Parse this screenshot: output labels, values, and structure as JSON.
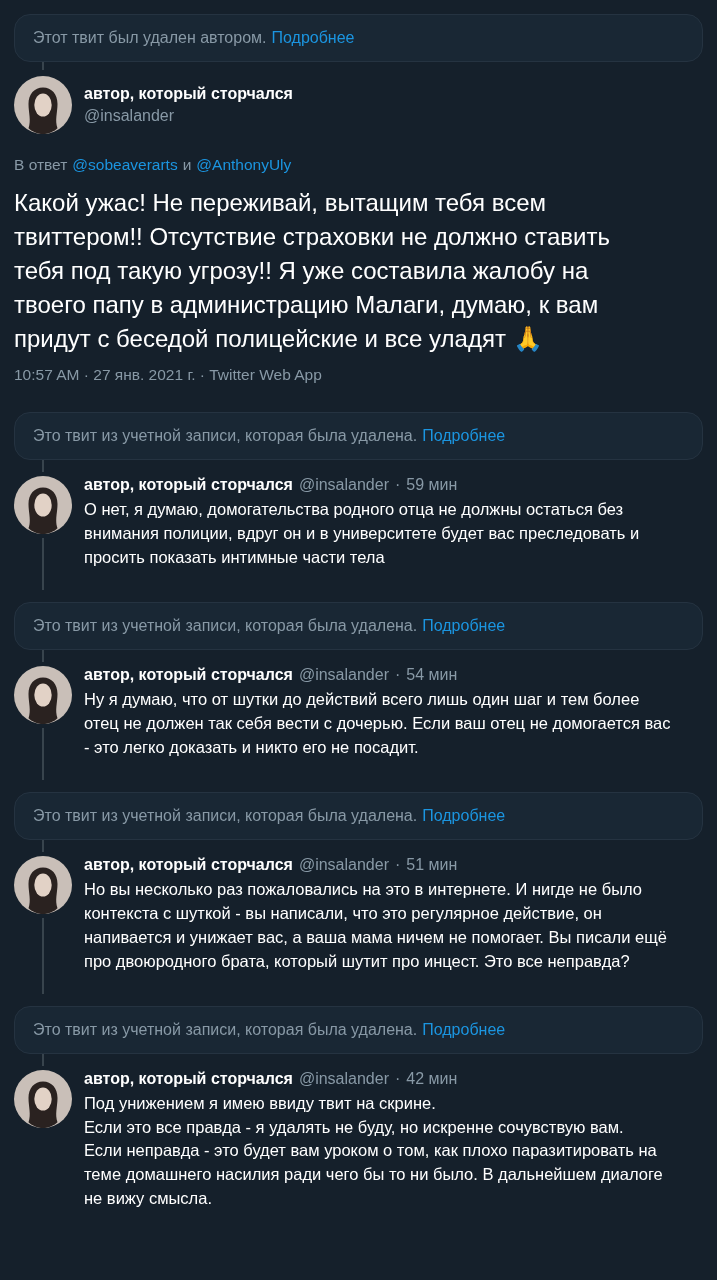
{
  "thread": [
    {
      "kind": "notice",
      "text": "Этот твит был удален автором.",
      "link": "Подробнее"
    },
    {
      "kind": "main",
      "name": "автор, который сторчался",
      "handle": "@insalander",
      "reply_prefix": "В ответ",
      "reply_to": [
        "@sobeaverarts",
        "@AnthonyUly"
      ],
      "reply_joiner": "и",
      "text": "Какой ужас! Не переживай, вытащим тебя всем твиттером!! Отсутствие страховки не должно ставить тебя под такую угрозу!! Я уже составила жалобу на твоего папу в администрацию Малаги, думаю, к вам придут с беседой полицейские и все уладят 🙏",
      "meta": "10:57 AM · 27 янв. 2021 г. · Twitter Web App"
    },
    {
      "kind": "notice",
      "text": "Это твит из учетной записи, которая была удалена.",
      "link": "Подробнее"
    },
    {
      "kind": "reply",
      "name": "автор, который сторчался",
      "handle": "@insalander",
      "separator": "·",
      "time": "59 мин",
      "text": "О нет, я думаю, домогательства родного отца не должны остаться без внимания полиции, вдруг он и в университете будет вас преследовать и просить показать интимные части тела"
    },
    {
      "kind": "notice",
      "text": "Это твит из учетной записи, которая была удалена.",
      "link": "Подробнее"
    },
    {
      "kind": "reply",
      "name": "автор, который сторчался",
      "handle": "@insalander",
      "separator": "·",
      "time": "54 мин",
      "text": "Ну я думаю, что от шутки до действий всего лишь один шаг и тем более отец не должен так себя вести с дочерью. Если ваш отец не домогается вас - это легко доказать и никто его не посадит."
    },
    {
      "kind": "notice",
      "text": "Это твит из учетной записи, которая была удалена.",
      "link": "Подробнее"
    },
    {
      "kind": "reply",
      "name": "автор, который сторчался",
      "handle": "@insalander",
      "separator": "·",
      "time": "51 мин",
      "text": "Но вы несколько раз пожаловались на это в интернете. И нигде не было контекста с шуткой - вы написали, что это регулярное действие, он напивается и унижает вас, а ваша мама ничем не помогает. Вы писали ещё про двоюродного брата, который шутит про инцест. Это все неправда?"
    },
    {
      "kind": "notice",
      "text": "Это твит из учетной записи, которая была удалена.",
      "link": "Подробнее"
    },
    {
      "kind": "reply",
      "name": "автор, который сторчался",
      "handle": "@insalander",
      "separator": "·",
      "time": "42 мин",
      "text": "Под унижением я имею ввиду твит на скрине.\nЕсли это все правда - я удалять не буду, но искренне сочувствую вам.\nЕсли неправда - это будет вам уроком о том, как плохо паразитировать на теме домашнего насилия ради чего бы то ни было. В дальнейшем диалоге не вижу смысла."
    }
  ]
}
